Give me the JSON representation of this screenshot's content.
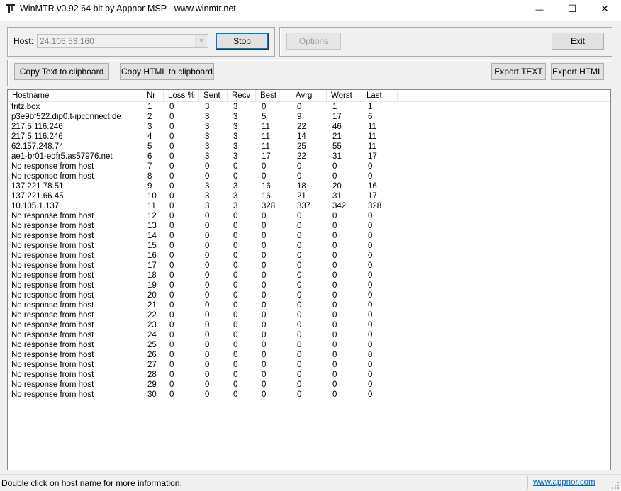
{
  "window": {
    "title": "WinMTR v0.92 64 bit by Appnor MSP - www.winmtr.net",
    "minimize_glyph": "—",
    "maximize_glyph": "☐",
    "close_glyph": "✕"
  },
  "toolbar": {
    "host_label": "Host:",
    "host_value": "24.105.53.160",
    "stop_label": "Stop",
    "options_label": "Options",
    "exit_label": "Exit",
    "copy_text_label": "Copy Text to clipboard",
    "copy_html_label": "Copy HTML to clipboard",
    "export_text_label": "Export TEXT",
    "export_html_label": "Export HTML"
  },
  "table": {
    "columns": [
      "Hostname",
      "Nr",
      "Loss %",
      "Sent",
      "Recv",
      "Best",
      "Avrg",
      "Worst",
      "Last"
    ],
    "rows": [
      [
        "fritz.box",
        "1",
        "0",
        "3",
        "3",
        "0",
        "0",
        "1",
        "1"
      ],
      [
        "p3e9bf522.dip0.t-ipconnect.de",
        "2",
        "0",
        "3",
        "3",
        "5",
        "9",
        "17",
        "6"
      ],
      [
        "217.5.116.246",
        "3",
        "0",
        "3",
        "3",
        "11",
        "22",
        "46",
        "11"
      ],
      [
        "217.5.116.246",
        "4",
        "0",
        "3",
        "3",
        "11",
        "14",
        "21",
        "11"
      ],
      [
        "62.157.248.74",
        "5",
        "0",
        "3",
        "3",
        "11",
        "25",
        "55",
        "11"
      ],
      [
        "ae1-br01-eqfr5.as57976.net",
        "6",
        "0",
        "3",
        "3",
        "17",
        "22",
        "31",
        "17"
      ],
      [
        "No response from host",
        "7",
        "0",
        "0",
        "0",
        "0",
        "0",
        "0",
        "0"
      ],
      [
        "No response from host",
        "8",
        "0",
        "0",
        "0",
        "0",
        "0",
        "0",
        "0"
      ],
      [
        "137.221.78.51",
        "9",
        "0",
        "3",
        "3",
        "16",
        "18",
        "20",
        "16"
      ],
      [
        "137.221.66.45",
        "10",
        "0",
        "3",
        "3",
        "16",
        "21",
        "31",
        "17"
      ],
      [
        "10.105.1.137",
        "11",
        "0",
        "3",
        "3",
        "328",
        "337",
        "342",
        "328"
      ],
      [
        "No response from host",
        "12",
        "0",
        "0",
        "0",
        "0",
        "0",
        "0",
        "0"
      ],
      [
        "No response from host",
        "13",
        "0",
        "0",
        "0",
        "0",
        "0",
        "0",
        "0"
      ],
      [
        "No response from host",
        "14",
        "0",
        "0",
        "0",
        "0",
        "0",
        "0",
        "0"
      ],
      [
        "No response from host",
        "15",
        "0",
        "0",
        "0",
        "0",
        "0",
        "0",
        "0"
      ],
      [
        "No response from host",
        "16",
        "0",
        "0",
        "0",
        "0",
        "0",
        "0",
        "0"
      ],
      [
        "No response from host",
        "17",
        "0",
        "0",
        "0",
        "0",
        "0",
        "0",
        "0"
      ],
      [
        "No response from host",
        "18",
        "0",
        "0",
        "0",
        "0",
        "0",
        "0",
        "0"
      ],
      [
        "No response from host",
        "19",
        "0",
        "0",
        "0",
        "0",
        "0",
        "0",
        "0"
      ],
      [
        "No response from host",
        "20",
        "0",
        "0",
        "0",
        "0",
        "0",
        "0",
        "0"
      ],
      [
        "No response from host",
        "21",
        "0",
        "0",
        "0",
        "0",
        "0",
        "0",
        "0"
      ],
      [
        "No response from host",
        "22",
        "0",
        "0",
        "0",
        "0",
        "0",
        "0",
        "0"
      ],
      [
        "No response from host",
        "23",
        "0",
        "0",
        "0",
        "0",
        "0",
        "0",
        "0"
      ],
      [
        "No response from host",
        "24",
        "0",
        "0",
        "0",
        "0",
        "0",
        "0",
        "0"
      ],
      [
        "No response from host",
        "25",
        "0",
        "0",
        "0",
        "0",
        "0",
        "0",
        "0"
      ],
      [
        "No response from host",
        "26",
        "0",
        "0",
        "0",
        "0",
        "0",
        "0",
        "0"
      ],
      [
        "No response from host",
        "27",
        "0",
        "0",
        "0",
        "0",
        "0",
        "0",
        "0"
      ],
      [
        "No response from host",
        "28",
        "0",
        "0",
        "0",
        "0",
        "0",
        "0",
        "0"
      ],
      [
        "No response from host",
        "29",
        "0",
        "0",
        "0",
        "0",
        "0",
        "0",
        "0"
      ],
      [
        "No response from host",
        "30",
        "0",
        "0",
        "0",
        "0",
        "0",
        "0",
        "0"
      ]
    ]
  },
  "status": {
    "text": "Double click on host name for more information.",
    "link": "www.appnor.com"
  },
  "colors": {
    "accent": "#0078d7",
    "link": "#0066cc"
  }
}
